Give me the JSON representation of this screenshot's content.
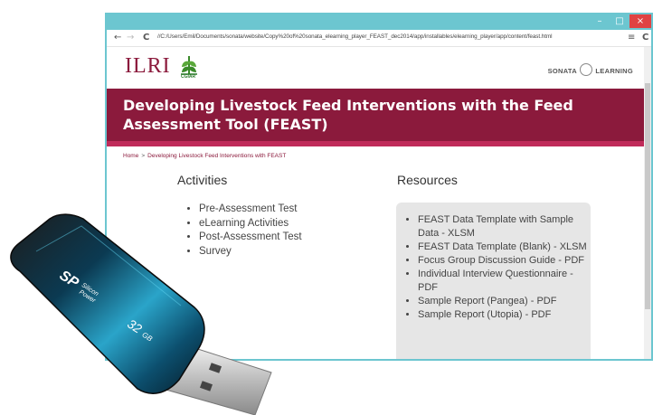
{
  "window": {
    "controls": {
      "minimize": "–",
      "maximize": "□",
      "close": "×"
    }
  },
  "nav": {
    "back_icon": "←",
    "forward_icon": "→",
    "reload_icon": "C",
    "url": "//C:/Users/Emil/Documents/sonata/website/Copy%20of%20sonata_elearning_player_FEAST_dec2014/app/installables/elearning_player/app/content/feast.html",
    "menu_icon": "≡",
    "reload2_icon": "C"
  },
  "header": {
    "logo_text": "ILRI",
    "cgiar_text": "CGIAR",
    "sonata_left": "SONATA",
    "sonata_right": "LEARNING"
  },
  "banner": {
    "title": "Developing Livestock Feed Interventions with the Feed Assessment Tool (FEAST)"
  },
  "breadcrumb": {
    "home": "Home",
    "separator": ">",
    "current": "Developing Livestock Feed Interventions with FEAST"
  },
  "activities": {
    "heading": "Activities",
    "items": [
      "Pre-Assessment Test",
      "eLearning Activities",
      "Post-Assessment Test",
      "Survey"
    ]
  },
  "resources": {
    "heading": "Resources",
    "items": [
      "FEAST Data Template with Sample Data - XLSM",
      "FEAST Data Template (Blank) - XLSM",
      "Focus Group Discussion Guide - PDF",
      "Individual Interview Questionnaire - PDF",
      "Sample Report (Pangea) - PDF",
      "Sample Report (Utopia) - PDF"
    ]
  },
  "usb": {
    "brand_sp": "SP",
    "brand_silicon": "Silicon",
    "brand_power": "Power",
    "capacity": "32",
    "capacity_unit": "GB"
  },
  "colors": {
    "banner": "#8b1a3c",
    "titlebar": "#6cc6d0",
    "usb_body": "#0f4f6b"
  }
}
